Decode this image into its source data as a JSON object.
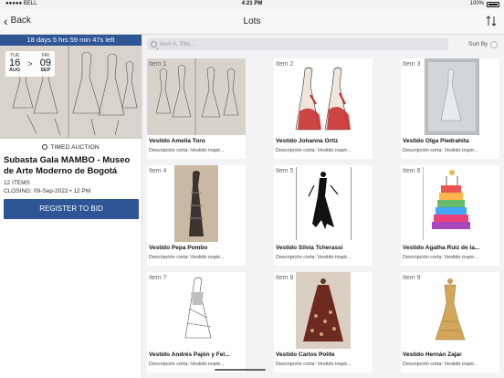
{
  "status_bar": {
    "carrier": "●●●●● BELL",
    "time": "4:21 PM",
    "battery": "100%"
  },
  "navbar": {
    "back_label": "Back",
    "title": "Lots",
    "sort_icon": "sort-arrows-icon"
  },
  "auction": {
    "timer": "18 days 5 hrs 59 min 47s left",
    "start": {
      "dow": "TUE",
      "day": "16",
      "month": "AUG"
    },
    "end": {
      "dow": "FRI",
      "day": "09",
      "month": "SEP"
    },
    "type": "TIMED AUCTION",
    "title": "Subasta Gala MAMBO - Museo de Arte Moderno de Bogotá",
    "items": "12 ITEMS",
    "closing": "CLOSING: 09-Sep-2022 • 12 PM",
    "register_label": "REGISTER TO BID"
  },
  "search": {
    "placeholder": "Item #, Title...",
    "sort_label": "Sort By"
  },
  "lots": [
    {
      "item": "Item 1",
      "name": "Vestido Amelia Toro",
      "desc": "Descripción corta: Vestido inspir..."
    },
    {
      "item": "Item 2",
      "name": "Vestido Johanna Ortiz",
      "desc": "Descripción corta: Vestido inspir..."
    },
    {
      "item": "Item 3",
      "name": "Vestido Olga Piedrahita",
      "desc": "Descripción corta: Vestido inspir..."
    },
    {
      "item": "Item 4",
      "name": "Vestido Pepa Pombo",
      "desc": "Descripción corta: Vestido inspir..."
    },
    {
      "item": "Item 5",
      "name": "Vestido Silvia Tcherassi",
      "desc": "Descripción corta: Vestido inspir..."
    },
    {
      "item": "Item 6",
      "name": "Vestido Agatha Ruiz de la...",
      "desc": "Descripción corta: Vestido inspir..."
    },
    {
      "item": "Item 7",
      "name": "Vestido Andrés Pajón y Fel...",
      "desc": "Descripción corta: Vestido inspir..."
    },
    {
      "item": "Item 8",
      "name": "Vestido Carlos Polite",
      "desc": "Descripción corta: Vestido inspir..."
    },
    {
      "item": "Item 9",
      "name": "Vestido Hernán Zajar",
      "desc": "Descripción corta: Vestido inspir..."
    }
  ],
  "colors": {
    "accent": "#2e5596"
  }
}
